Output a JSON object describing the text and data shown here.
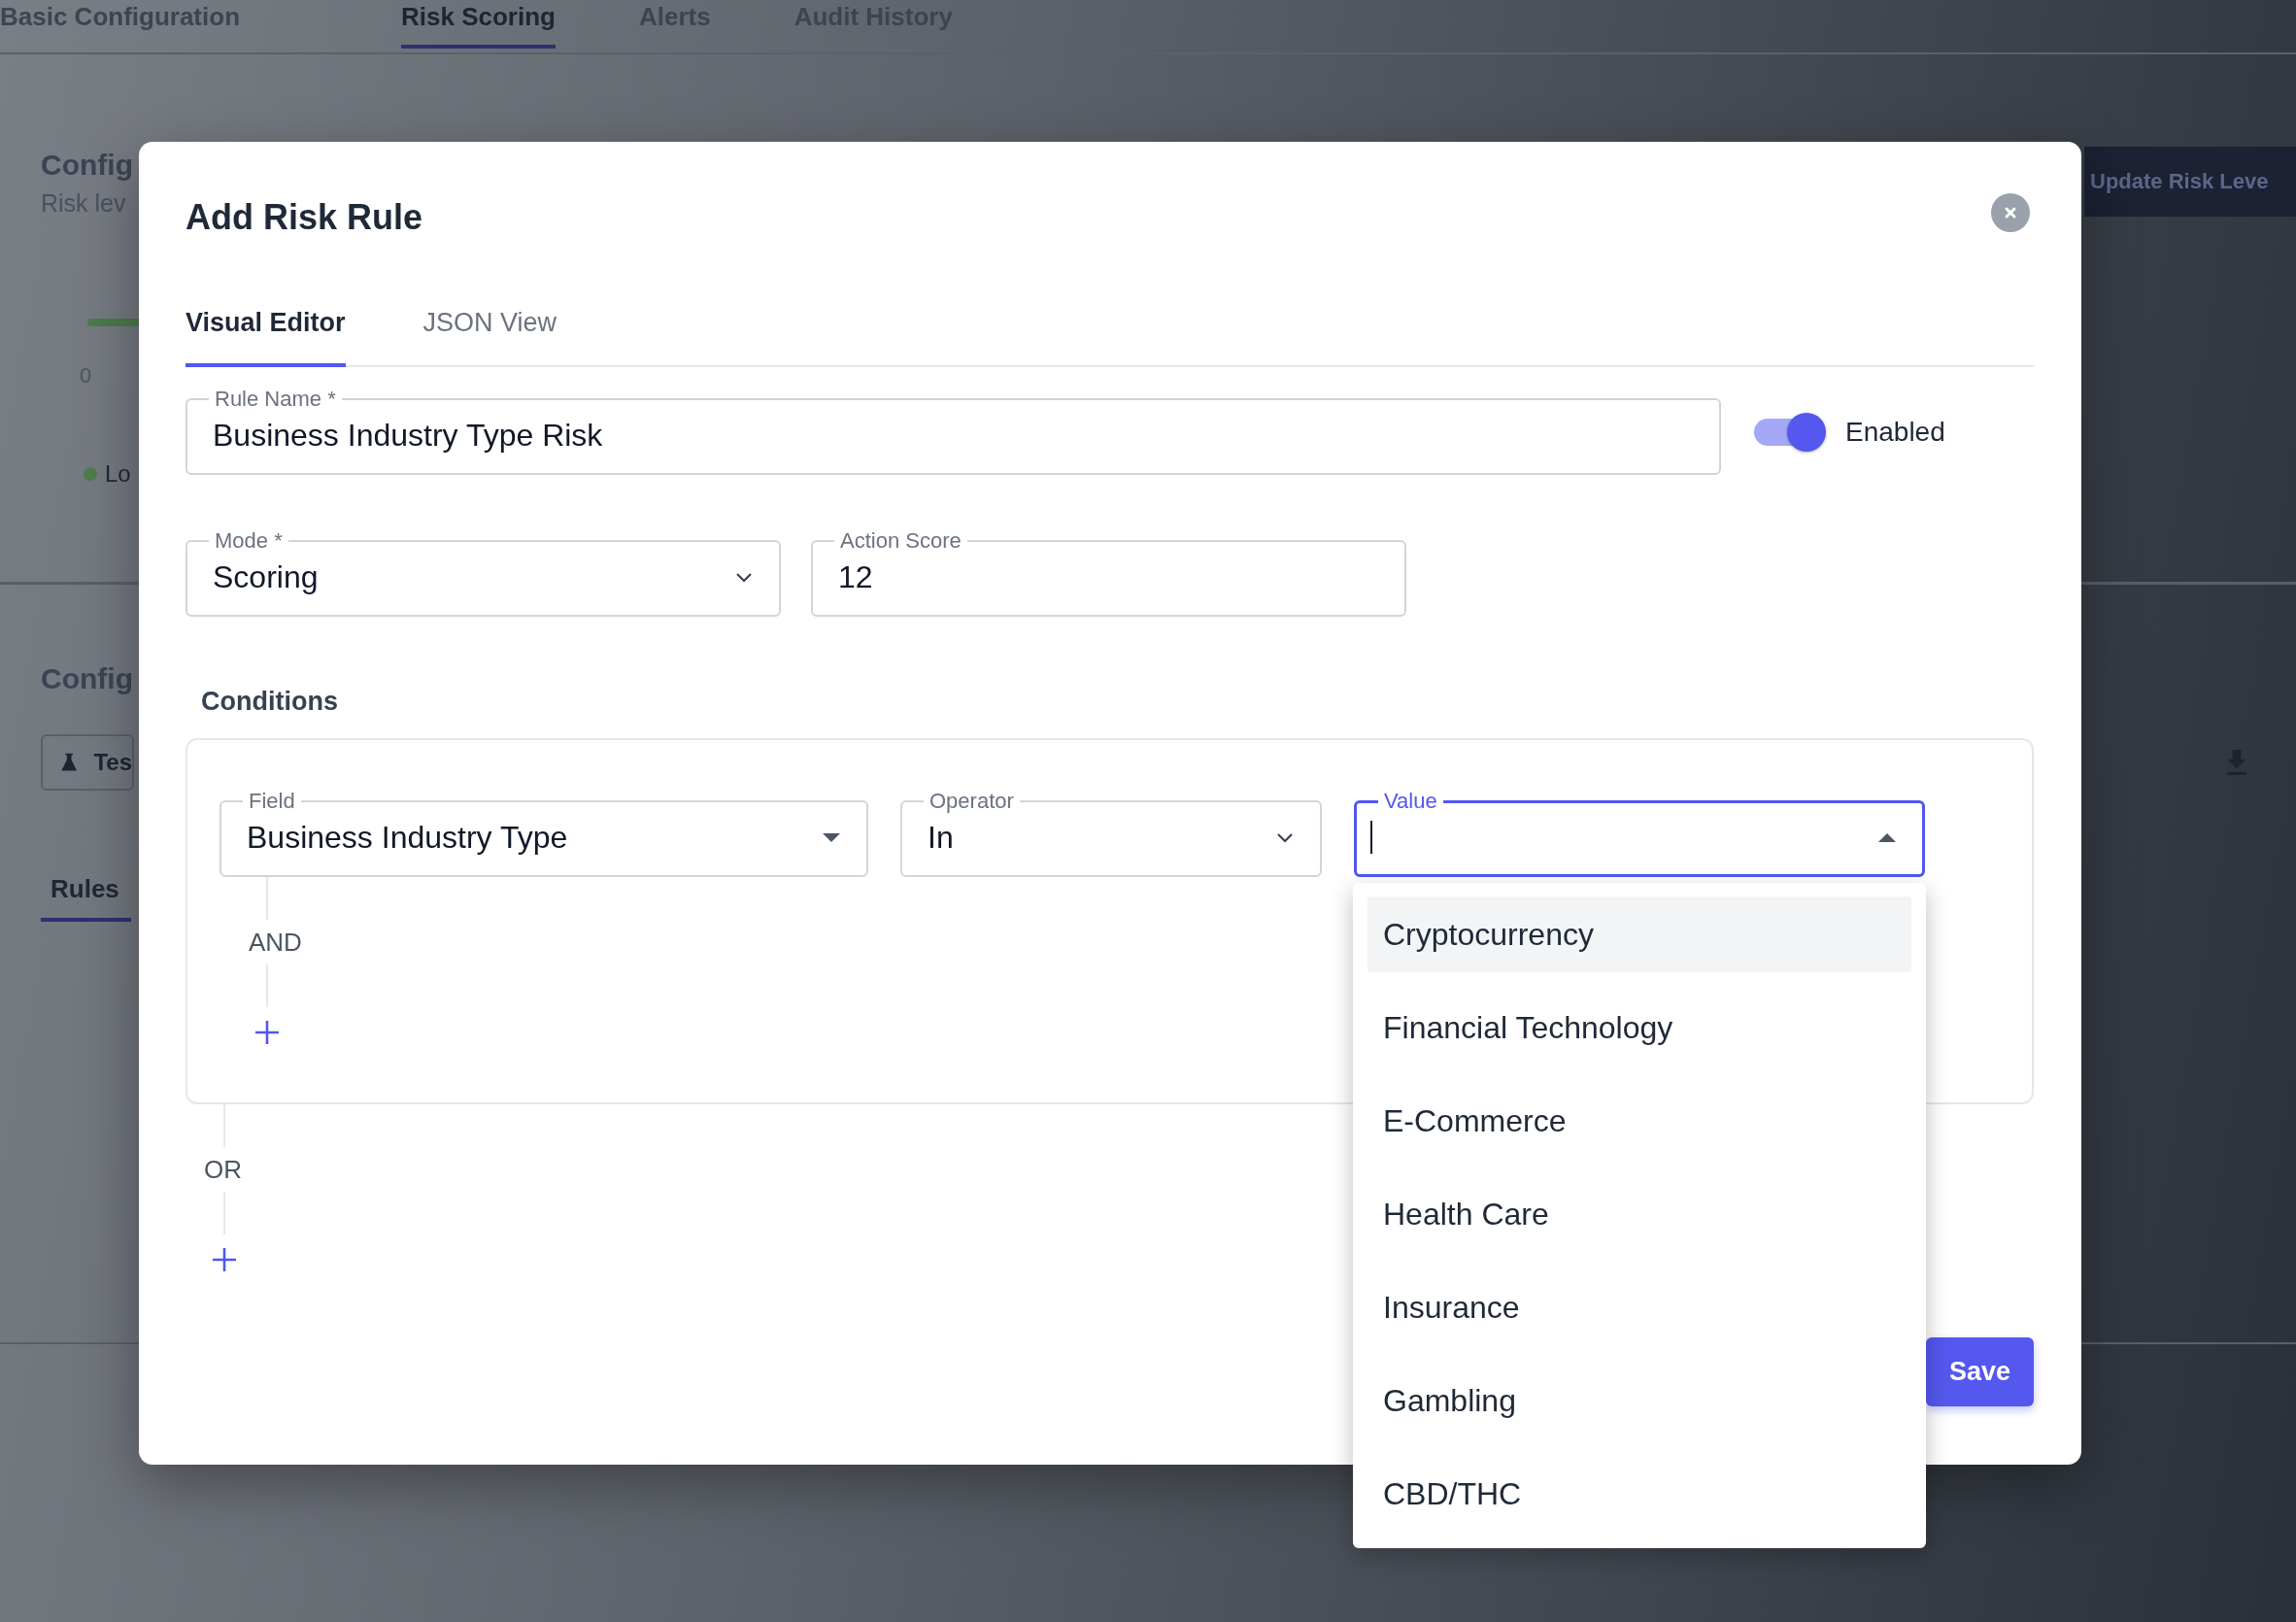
{
  "page_tabs": [
    {
      "label": "Basic Configuration",
      "selected": false
    },
    {
      "label": "Risk Scoring",
      "selected": true
    },
    {
      "label": "Alerts",
      "selected": false
    },
    {
      "label": "Audit History",
      "selected": false
    }
  ],
  "risk_levels": {
    "heading": "Config",
    "subtitle": "Risk lev",
    "update_button": "Update Risk Leve",
    "scale_start": "0",
    "legend": [
      {
        "label": "Lo",
        "color": "#4f7d4c"
      }
    ]
  },
  "rules_panel": {
    "heading": "Config",
    "test_button": "Tes",
    "tabs": [
      {
        "label": "Rules",
        "selected": true
      }
    ]
  },
  "dialog": {
    "title": "Add Risk Rule",
    "tabs": [
      {
        "label": "Visual Editor",
        "selected": true
      },
      {
        "label": "JSON View",
        "selected": false
      }
    ],
    "rule_name": {
      "label": "Rule Name *",
      "value": "Business Industry Type Risk",
      "focused": false
    },
    "enabled": {
      "label": "Enabled",
      "on": true
    },
    "mode": {
      "label": "Mode *",
      "value": "Scoring",
      "kind": "select",
      "focused": false
    },
    "action_score": {
      "label": "Action Score",
      "value": "12",
      "focused": false
    },
    "conditions": {
      "title": "Conditions",
      "joiner": "OR",
      "groups": [
        {
          "joiner": "AND",
          "conditions": [
            {
              "field": {
                "label": "Field",
                "value": "Business Industry Type",
                "kind": "autocomplete",
                "focused": false,
                "open": false
              },
              "operator": {
                "label": "Operator",
                "value": "In",
                "kind": "select",
                "focused": false
              },
              "value": {
                "label": "Value",
                "kind": "autocomplete",
                "focused": true,
                "open": true
              }
            }
          ]
        }
      ]
    },
    "value_options": [
      {
        "label": "Cryptocurrency",
        "highlighted": true
      },
      {
        "label": "Financial Technology",
        "highlighted": false
      },
      {
        "label": "E-Commerce",
        "highlighted": false
      },
      {
        "label": "Health Care",
        "highlighted": false
      },
      {
        "label": "Insurance",
        "highlighted": false
      },
      {
        "label": "Gambling",
        "highlighted": false
      },
      {
        "label": "CBD/THC",
        "highlighted": false
      }
    ],
    "save_button": "Save"
  }
}
